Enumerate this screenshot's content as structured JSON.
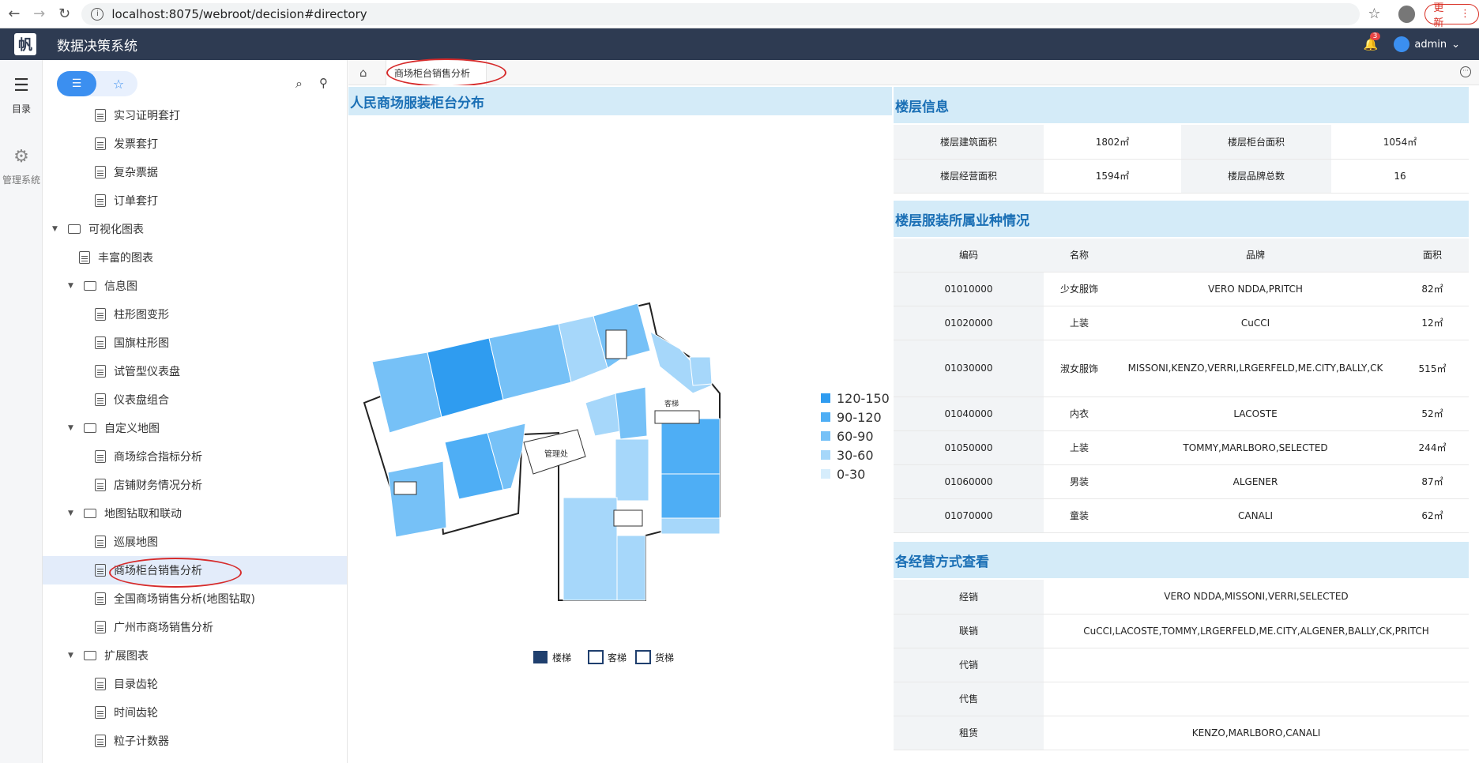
{
  "browser": {
    "url": "localhost:8075/webroot/decision#directory",
    "update_label": "更新"
  },
  "header": {
    "logo_text": "帆",
    "title": "数据决策系统",
    "notification_count": "3",
    "user": "admin"
  },
  "leftnav": {
    "items": [
      {
        "label": "目录",
        "icon": "list-icon"
      },
      {
        "label": "管理系统",
        "icon": "gear-icon"
      }
    ]
  },
  "tree": {
    "nodes": [
      {
        "label": "实习证明套打",
        "type": "file",
        "indent": 2
      },
      {
        "label": "发票套打",
        "type": "file",
        "indent": 2
      },
      {
        "label": "复杂票据",
        "type": "file",
        "indent": 2
      },
      {
        "label": "订单套打",
        "type": "file",
        "indent": 2
      },
      {
        "label": "可视化图表",
        "type": "folder",
        "indent": 0
      },
      {
        "label": "丰富的图表",
        "type": "file",
        "indent": 1
      },
      {
        "label": "信息图",
        "type": "folder",
        "indent": 1
      },
      {
        "label": "柱形图变形",
        "type": "file",
        "indent": 2
      },
      {
        "label": "国旗柱形图",
        "type": "file",
        "indent": 2
      },
      {
        "label": "试管型仪表盘",
        "type": "file",
        "indent": 2
      },
      {
        "label": "仪表盘组合",
        "type": "file",
        "indent": 2
      },
      {
        "label": "自定义地图",
        "type": "folder",
        "indent": 1
      },
      {
        "label": "商场综合指标分析",
        "type": "file",
        "indent": 2
      },
      {
        "label": "店铺财务情况分析",
        "type": "file",
        "indent": 2
      },
      {
        "label": "地图钻取和联动",
        "type": "folder",
        "indent": 1
      },
      {
        "label": "巡展地图",
        "type": "file",
        "indent": 2
      },
      {
        "label": "商场柜台销售分析",
        "type": "file",
        "indent": 2,
        "selected": true
      },
      {
        "label": "全国商场销售分析(地图钻取)",
        "type": "file",
        "indent": 2
      },
      {
        "label": "广州市商场销售分析",
        "type": "file",
        "indent": 2
      },
      {
        "label": "扩展图表",
        "type": "folder",
        "indent": 1
      },
      {
        "label": "目录齿轮",
        "type": "file",
        "indent": 2
      },
      {
        "label": "时间齿轮",
        "type": "file",
        "indent": 2
      },
      {
        "label": "粒子计数器",
        "type": "file",
        "indent": 2
      }
    ]
  },
  "tab": {
    "label": "商场柜台销售分析"
  },
  "map_section": {
    "title": "人民商场服装柜台分布",
    "legend": [
      {
        "label": "120-150",
        "color": "#2f9cf0"
      },
      {
        "label": "90-120",
        "color": "#4eaef5"
      },
      {
        "label": "60-90",
        "color": "#76c1f7"
      },
      {
        "label": "30-60",
        "color": "#a6d7fa"
      },
      {
        "label": "0-30",
        "color": "#d6edfc"
      }
    ],
    "room_label": "管理处",
    "sign_label": "客梯",
    "facilities": [
      {
        "label": "楼梯",
        "icon": "stairs-icon"
      },
      {
        "label": "客梯",
        "icon": "passenger-elevator-icon"
      },
      {
        "label": "货梯",
        "icon": "freight-elevator-icon"
      }
    ]
  },
  "floor_info": {
    "title": "楼层信息",
    "rows": [
      [
        {
          "label": "楼层建筑面积",
          "value": "1802㎡"
        },
        {
          "label": "楼层柜台面积",
          "value": "1054㎡"
        }
      ],
      [
        {
          "label": "楼层经营面积",
          "value": "1594㎡"
        },
        {
          "label": "楼层品牌总数",
          "value": "16"
        }
      ]
    ]
  },
  "category_table": {
    "title": "楼层服装所属业种情况",
    "headers": [
      "编码",
      "名称",
      "品牌",
      "面积"
    ],
    "rows": [
      [
        "01010000",
        "少女服饰",
        "VERO NDDA,PRITCH",
        "82㎡"
      ],
      [
        "01020000",
        "上装",
        "CuCCI",
        "12㎡"
      ],
      [
        "01030000",
        "淑女服饰",
        "MISSONI,KENZO,VERRI,LRGERFELD,ME.CITY,BALLY,CK",
        "515㎡"
      ],
      [
        "01040000",
        "内衣",
        "LACOSTE",
        "52㎡"
      ],
      [
        "01050000",
        "上装",
        "TOMMY,MARLBORO,SELECTED",
        "244㎡"
      ],
      [
        "01060000",
        "男装",
        "ALGENER",
        "87㎡"
      ],
      [
        "01070000",
        "童装",
        "CANALI",
        "62㎡"
      ]
    ]
  },
  "mode_table": {
    "title": "各经营方式查看",
    "rows": [
      [
        "经销",
        "VERO NDDA,MISSONI,VERRI,SELECTED"
      ],
      [
        "联销",
        "CuCCI,LACOSTE,TOMMY,LRGERFELD,ME.CITY,ALGENER,BALLY,CK,PRITCH"
      ],
      [
        "代销",
        ""
      ],
      [
        "代售",
        ""
      ],
      [
        "租赁",
        "KENZO,MARLBORO,CANALI"
      ]
    ]
  }
}
